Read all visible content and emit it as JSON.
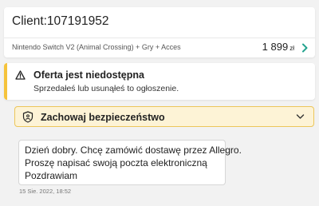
{
  "header": {
    "client_label": "Client:107191952",
    "offer": {
      "title": "Nintendo Switch V2 (Animal Crossing) + Gry + Acces",
      "price": "1 899",
      "currency": "zł",
      "chevron_icon": "chevron-right-icon"
    }
  },
  "alert": {
    "icon": "warning-triangle-icon",
    "title": "Oferta jest niedostępna",
    "text": "Sprzedałeś lub usunąłeś to ogłoszenie."
  },
  "safety": {
    "icon": "shield-icon",
    "label": "Zachowaj bezpieczeństwo",
    "chevron_icon": "chevron-down-icon"
  },
  "message": {
    "lines": [
      "Dzień dobry. Chcę zamówić dostawę przez Allegro.",
      "Proszę napisać swoją poczta elektroniczną",
      "Pozdrawiam"
    ],
    "timestamp": "15 Sie. 2022, 18:52"
  },
  "colors": {
    "warning_accent": "#f5c33b",
    "safety_background": "#fdf3d6",
    "safety_border": "#ecc65a",
    "link_chevron": "#23a38e"
  }
}
